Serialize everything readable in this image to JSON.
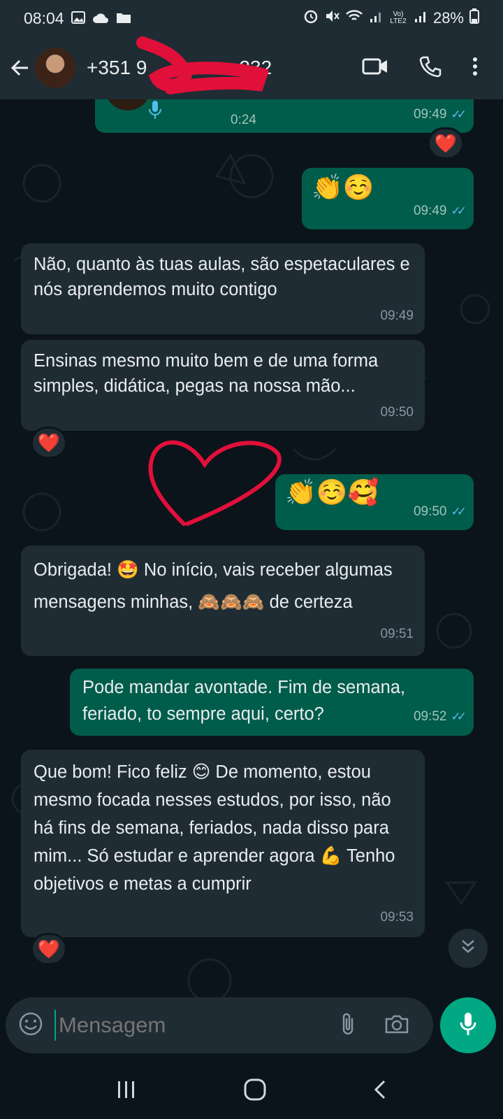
{
  "status": {
    "time": "08:04",
    "battery": "28%",
    "network_label": "Vo) LTE2"
  },
  "header": {
    "contact_prefix": "+351 9",
    "contact_suffix": "232"
  },
  "messages": [
    {
      "dir": "out",
      "type": "voice",
      "duration": "0:24",
      "time": "09:49"
    },
    {
      "dir": "out",
      "text": "👏☺️",
      "time": "09:49"
    },
    {
      "dir": "in",
      "text": "Não, quanto às tuas aulas, são espetaculares e nós aprendemos muito contigo",
      "time": "09:49"
    },
    {
      "dir": "in",
      "text": "Ensinas mesmo muito bem e de uma forma simples, didática, pegas na nossa mão...",
      "time": "09:50"
    },
    {
      "dir": "out",
      "text": "👏☺️🥰",
      "time": "09:50"
    },
    {
      "dir": "in",
      "text": "Obrigada! 🤩 No início, vais receber algumas mensagens minhas, 🙈🙈🙈 de certeza",
      "time": "09:51"
    },
    {
      "dir": "out",
      "text": "Pode mandar avontade. Fim de semana, feriado, to sempre aqui, certo?",
      "time": "09:52"
    },
    {
      "dir": "in",
      "text": "Que bom! Fico feliz 😊 De momento, estou mesmo focada nesses estudos, por isso, não há fins de semana, feriados, nada disso para mim... Só estudar e aprender agora 💪 Tenho objetivos e metas a cumprir",
      "time": "09:53"
    }
  ],
  "reactions": {
    "heart": "❤️"
  },
  "composer": {
    "placeholder": "Mensagem"
  },
  "colors": {
    "accent": "#00a884",
    "outgoing": "#005c4b",
    "incoming": "#1f2c34",
    "background": "#0b141a"
  }
}
